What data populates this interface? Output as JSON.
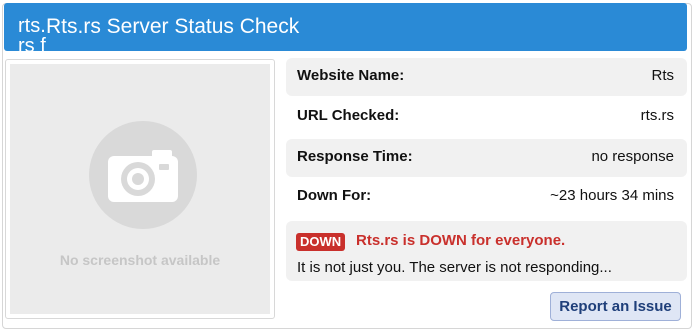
{
  "header": {
    "favicon_alt": "rts.rs favicon",
    "title": "Rts.rs Server Status Check"
  },
  "screenshot": {
    "icon": "camera-icon",
    "placeholder_text": "No screenshot available"
  },
  "info": [
    {
      "label": "Website Name:",
      "value": "Rts"
    },
    {
      "label": "URL Checked:",
      "value": "rts.rs"
    },
    {
      "label": "Response Time:",
      "value": "no response"
    },
    {
      "label": "Down For:",
      "value": "~23 hours 34 mins"
    }
  ],
  "status": {
    "badge": "DOWN",
    "headline": "Rts.rs is DOWN for everyone.",
    "detail": "It is not just you. The server is not responding..."
  },
  "actions": {
    "report_label": "Report an Issue"
  },
  "colors": {
    "header": "#2a8ad6",
    "down": "#c9302c",
    "row_shade": "#f1f1f1"
  }
}
